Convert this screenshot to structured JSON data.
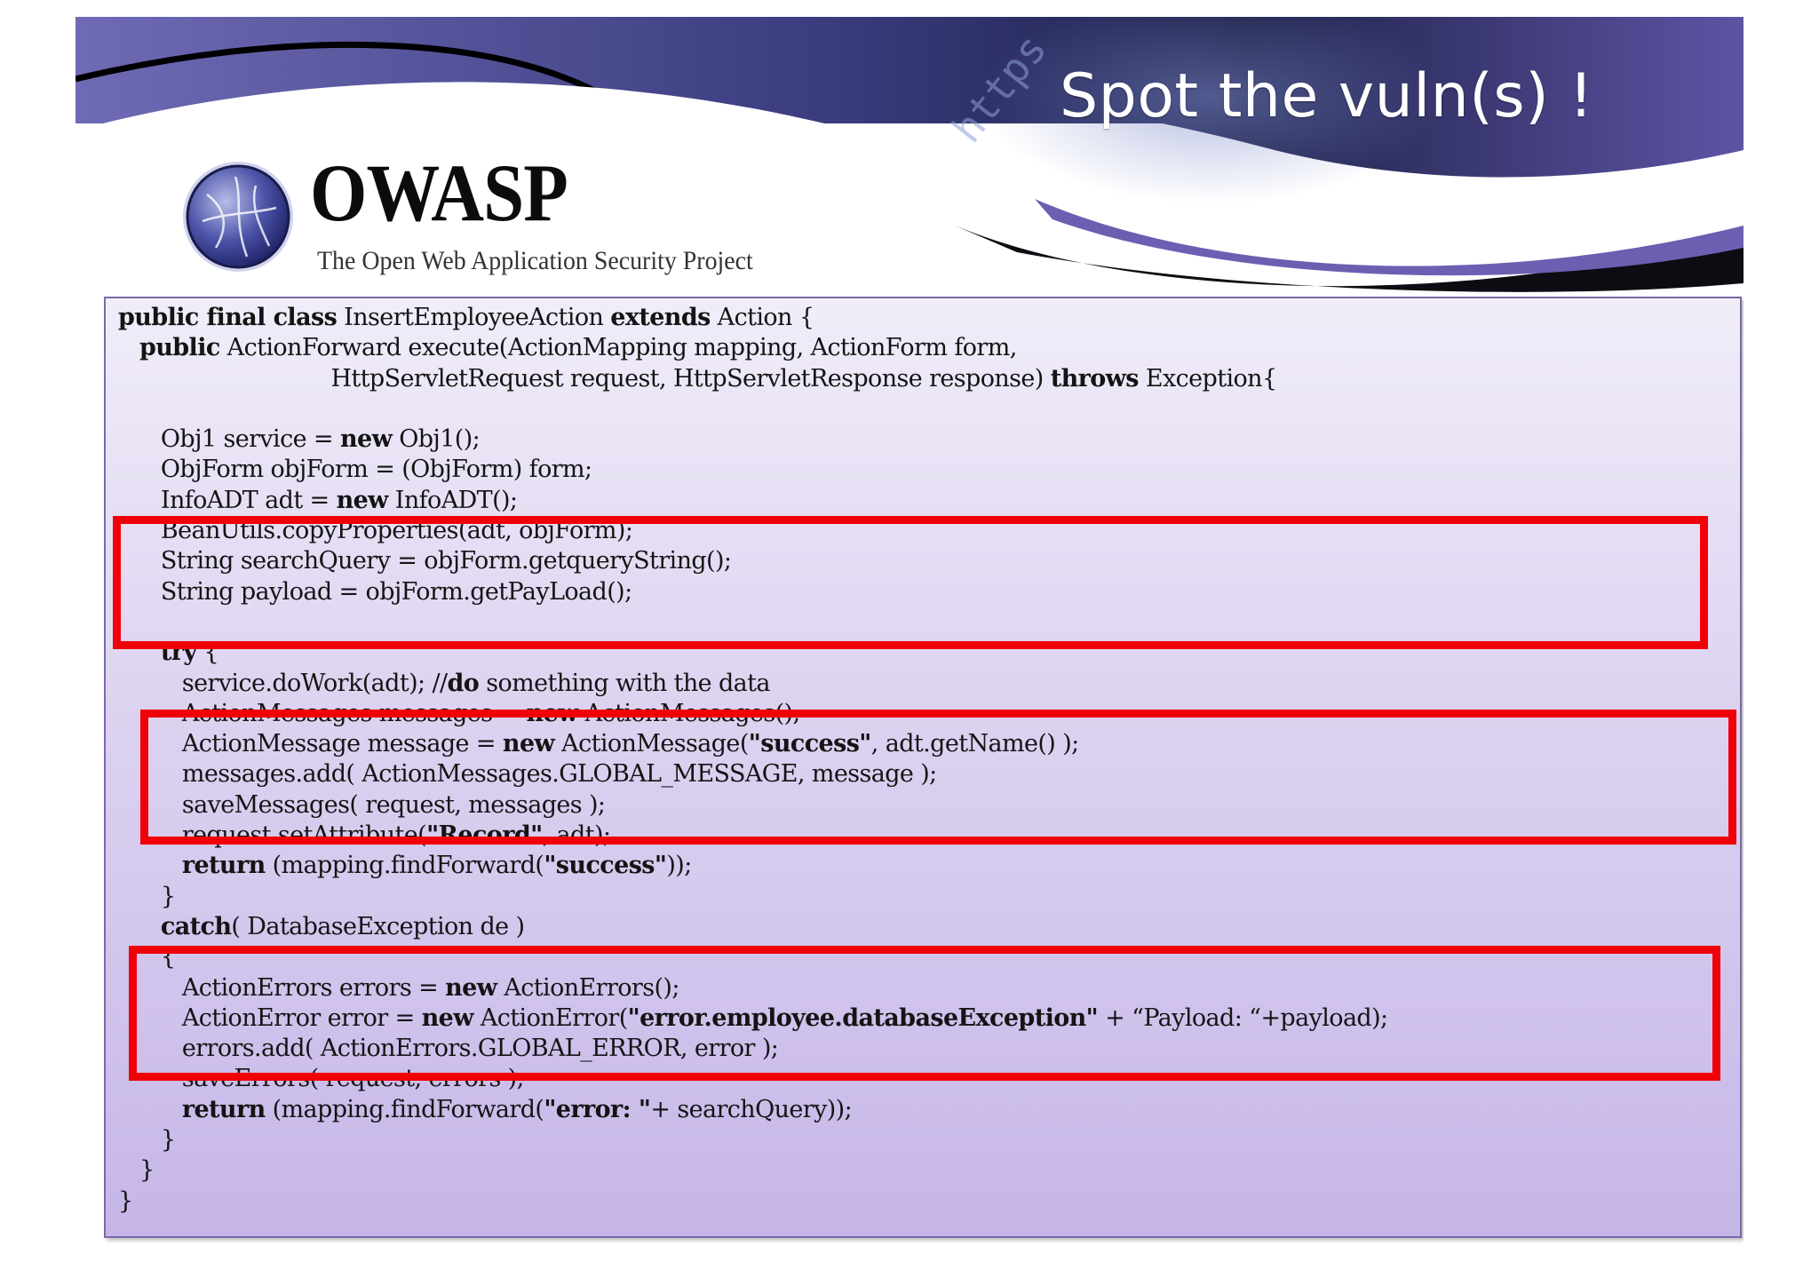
{
  "slide": {
    "title": "Spot the vuln(s) !",
    "url_fragment": "https"
  },
  "logo": {
    "name": "OWASP",
    "tagline": "The Open Web Application Security Project"
  },
  "code": {
    "lines": [
      [
        {
          "t": "public final class",
          "b": true
        },
        {
          "t": " InsertEmployeeAction "
        },
        {
          "t": "extends",
          "b": true
        },
        {
          "t": " Action {"
        }
      ],
      [
        {
          "t": "   "
        },
        {
          "t": "public",
          "b": true
        },
        {
          "t": " ActionForward execute(ActionMapping mapping, ActionForm form,"
        }
      ],
      [
        {
          "t": "                              HttpServletRequest request, HttpServletResponse response) "
        },
        {
          "t": "throws",
          "b": true
        },
        {
          "t": " Exception{"
        }
      ],
      [
        {
          "t": ""
        }
      ],
      [
        {
          "t": "      Obj1 service = "
        },
        {
          "t": "new",
          "b": true
        },
        {
          "t": " Obj1();"
        }
      ],
      [
        {
          "t": "      ObjForm objForm = (ObjForm) form;"
        }
      ],
      [
        {
          "t": "      InfoADT adt = "
        },
        {
          "t": "new",
          "b": true
        },
        {
          "t": " InfoADT();"
        }
      ],
      [
        {
          "t": "      BeanUtils.copyProperties(adt, objForm);"
        }
      ],
      [
        {
          "t": "      String searchQuery = objForm.getqueryString();"
        }
      ],
      [
        {
          "t": "      String payload = objForm.getPayLoad();"
        }
      ],
      [
        {
          "t": ""
        }
      ],
      [
        {
          "t": "      "
        },
        {
          "t": "try",
          "b": true
        },
        {
          "t": " {"
        }
      ],
      [
        {
          "t": "         service.doWork(adt); //"
        },
        {
          "t": "do",
          "b": true
        },
        {
          "t": " something with the data"
        }
      ],
      [
        {
          "t": "         ActionMessages messages = "
        },
        {
          "t": "new",
          "b": true
        },
        {
          "t": " ActionMessages();"
        }
      ],
      [
        {
          "t": "         ActionMessage message = "
        },
        {
          "t": "new",
          "b": true
        },
        {
          "t": " ActionMessage("
        },
        {
          "t": "\"success\"",
          "b": true
        },
        {
          "t": ", adt.getName() );"
        }
      ],
      [
        {
          "t": "         messages.add( ActionMessages.GLOBAL_MESSAGE, message );"
        }
      ],
      [
        {
          "t": "         saveMessages( request, messages );"
        }
      ],
      [
        {
          "t": "         request.setAttribute("
        },
        {
          "t": "\"Record\"",
          "b": true
        },
        {
          "t": ", adt);"
        }
      ],
      [
        {
          "t": "         "
        },
        {
          "t": "return",
          "b": true
        },
        {
          "t": " (mapping.findForward("
        },
        {
          "t": "\"success\"",
          "b": true
        },
        {
          "t": "));"
        }
      ],
      [
        {
          "t": "      }"
        }
      ],
      [
        {
          "t": "      "
        },
        {
          "t": "catch",
          "b": true
        },
        {
          "t": "( DatabaseException de )"
        }
      ],
      [
        {
          "t": "      {"
        }
      ],
      [
        {
          "t": "         ActionErrors errors = "
        },
        {
          "t": "new",
          "b": true
        },
        {
          "t": " ActionErrors();"
        }
      ],
      [
        {
          "t": "         ActionError error = "
        },
        {
          "t": "new",
          "b": true
        },
        {
          "t": " ActionError("
        },
        {
          "t": "\"error.employee.databaseException\"",
          "b": true
        },
        {
          "t": " + “Payload: “+payload);"
        }
      ],
      [
        {
          "t": "         errors.add( ActionErrors.GLOBAL_ERROR, error );"
        }
      ],
      [
        {
          "t": "         saveErrors( request, errors );"
        }
      ],
      [
        {
          "t": "         "
        },
        {
          "t": "return",
          "b": true
        },
        {
          "t": " (mapping.findForward("
        },
        {
          "t": "\"error: \"",
          "b": true
        },
        {
          "t": "+ searchQuery));"
        }
      ],
      [
        {
          "t": "      }"
        }
      ],
      [
        {
          "t": "   }"
        }
      ],
      [
        {
          "t": "}"
        }
      ]
    ]
  },
  "colors": {
    "highlight_box": "#f00007",
    "banner_purple": "#5d54a4",
    "banner_dark": "#101020",
    "panel_top": "#f1edf9",
    "panel_bottom": "#c6b6e8"
  }
}
